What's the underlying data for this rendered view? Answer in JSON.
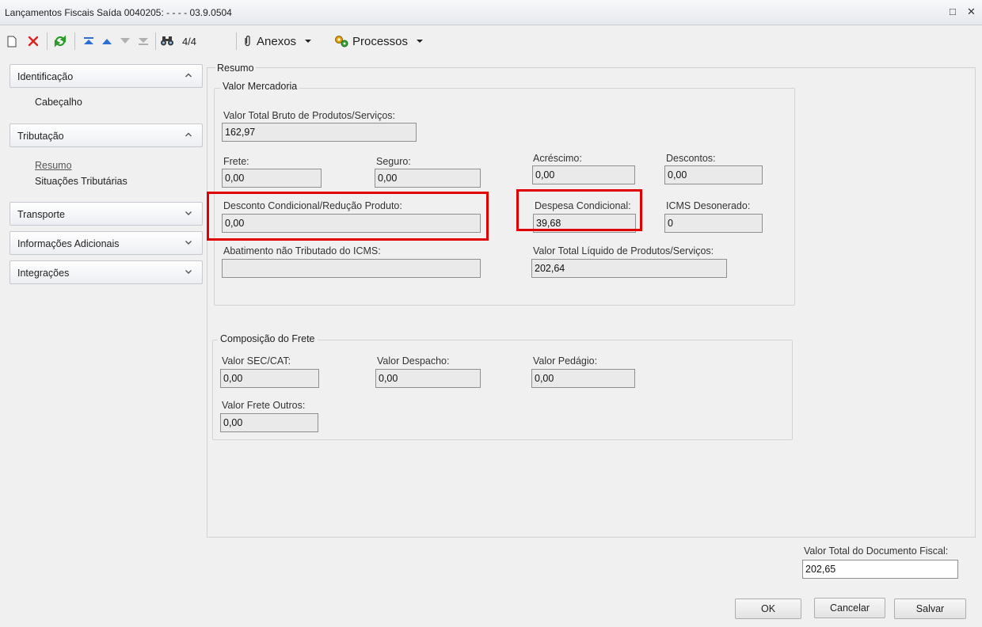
{
  "window": {
    "title": "Lançamentos Fiscais Saída 0040205: - - - - 03.9.0504",
    "maximize_glyph": "□",
    "close_glyph": "✕"
  },
  "toolbar": {
    "record_counter": "4/4",
    "anexos_label": "Anexos",
    "processos_label": "Processos"
  },
  "sidebar": {
    "sections": [
      {
        "label": "Identificação",
        "expanded": true,
        "items": [
          "Cabeçalho"
        ]
      },
      {
        "label": "Tributação",
        "expanded": true,
        "items": [
          "Resumo",
          "Situações Tributárias"
        ]
      },
      {
        "label": "Transporte",
        "expanded": false
      },
      {
        "label": "Informações Adicionais",
        "expanded": false
      },
      {
        "label": "Integrações",
        "expanded": false
      }
    ]
  },
  "page": {
    "section_title": "Resumo"
  },
  "valor_mercadoria": {
    "title": "Valor Mercadoria",
    "fields": {
      "valor_total_bruto": {
        "label": "Valor Total Bruto de Produtos/Serviços:",
        "value": "162,97"
      },
      "frete": {
        "label": "Frete:",
        "value": "0,00"
      },
      "seguro": {
        "label": "Seguro:",
        "value": "0,00"
      },
      "acrescimo": {
        "label": "Acréscimo:",
        "value": "0,00"
      },
      "descontos": {
        "label": "Descontos:",
        "value": "0,00"
      },
      "desconto_condicional": {
        "label": "Desconto Condicional/Redução Produto:",
        "value": "0,00"
      },
      "despesa_condicional": {
        "label": "Despesa Condicional:",
        "value": "39,68"
      },
      "icms_desonerado": {
        "label": "ICMS Desonerado:",
        "value": "0"
      },
      "abatimento": {
        "label": "Abatimento não Tributado do ICMS:",
        "value": ""
      },
      "valor_total_liquido": {
        "label": "Valor Total Líquido de Produtos/Serviços:",
        "value": "202,64"
      }
    }
  },
  "composicao_frete": {
    "title": "Composição do Frete",
    "fields": {
      "valor_sec_cat": {
        "label": "Valor SEC/CAT:",
        "value": "0,00"
      },
      "valor_despacho": {
        "label": "Valor Despacho:",
        "value": "0,00"
      },
      "valor_pedagio": {
        "label": "Valor Pedágio:",
        "value": "0,00"
      },
      "valor_frete_outros": {
        "label": "Valor Frete Outros:",
        "value": "0,00"
      }
    }
  },
  "footer": {
    "valor_total_documento": {
      "label": "Valor Total do Documento Fiscal:",
      "value": "202,65"
    },
    "ok_label": "OK",
    "cancelar_label": "Cancelar",
    "salvar_label": "Salvar"
  },
  "colors": {
    "highlight": "#e00000",
    "delete_red": "#e02020",
    "refresh_green": "#2a9a2a",
    "nav_blue": "#2b6fd6"
  }
}
